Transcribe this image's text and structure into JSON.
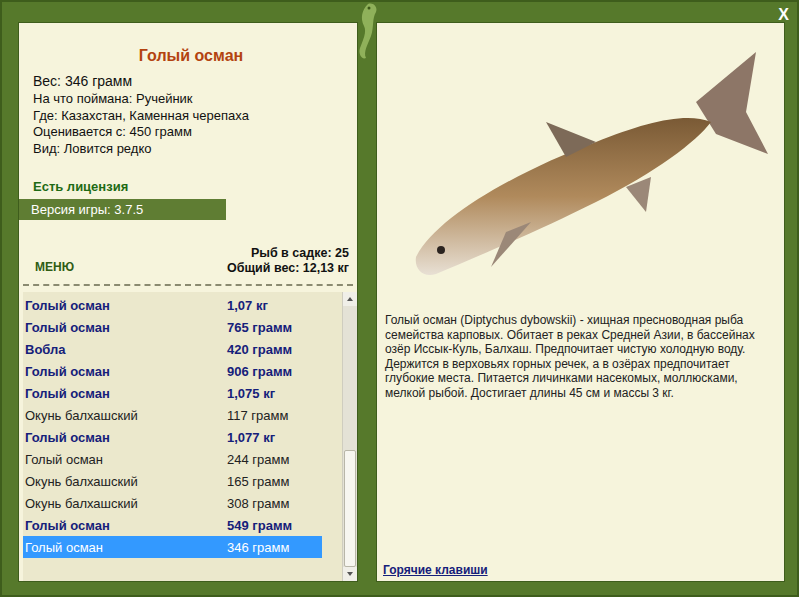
{
  "window": {
    "close": "X"
  },
  "fish": {
    "title": "Голый осман",
    "weight": "Вес: 346 грамм",
    "details": [
      "На что поймана: Ручейник",
      "Где: Казахстан, Каменная черепаха",
      "Оценивается с: 450 грамм",
      "Вид: Ловится редко"
    ]
  },
  "license": "Есть лицензия",
  "version": "Версия игры: 3.7.5",
  "menu": "МЕНЮ",
  "stats": [
    "Рыб в садке: 25",
    "Общий вес: 12,13 кг"
  ],
  "catch_list": [
    {
      "name": "Голый осман",
      "weight": "1,07 кг",
      "highlighted": true,
      "selected": false
    },
    {
      "name": "Голый осман",
      "weight": "765 грамм",
      "highlighted": true,
      "selected": false
    },
    {
      "name": "Вобла",
      "weight": "420 грамм",
      "highlighted": true,
      "selected": false
    },
    {
      "name": "Голый осман",
      "weight": "906 грамм",
      "highlighted": true,
      "selected": false
    },
    {
      "name": "Голый осман",
      "weight": "1,075 кг",
      "highlighted": true,
      "selected": false
    },
    {
      "name": "Окунь балхашский",
      "weight": "117 грамм",
      "highlighted": false,
      "selected": false
    },
    {
      "name": "Голый осман",
      "weight": "1,077 кг",
      "highlighted": true,
      "selected": false
    },
    {
      "name": "Голый осман",
      "weight": "244 грамм",
      "highlighted": false,
      "selected": false
    },
    {
      "name": "Окунь балхашский",
      "weight": "165 грамм",
      "highlighted": false,
      "selected": false
    },
    {
      "name": "Окунь балхашский",
      "weight": "308 грамм",
      "highlighted": false,
      "selected": false
    },
    {
      "name": "Голый осман",
      "weight": "549 грамм",
      "highlighted": true,
      "selected": false
    },
    {
      "name": "Голый осман",
      "weight": "346 грамм",
      "highlighted": false,
      "selected": true
    }
  ],
  "scrollbar": {
    "level": 1
  },
  "description": "Голый осман (Diptychus dybowskii) - хищная пресноводная рыба семейства карповых. Обитает в реках Средней Азии, в бассейнах озёр Иссык-Куль, Балхаш. Предпочитает чистую холодную воду. Держится в верховьях горных речек, а в озёрах предпочитает глубокие места. Питается личинками насекомых, моллюсками, мелкой рыбой. Достигает длины 45 см и массы 3 кг.",
  "hotkeys": "Горячие клавиши"
}
